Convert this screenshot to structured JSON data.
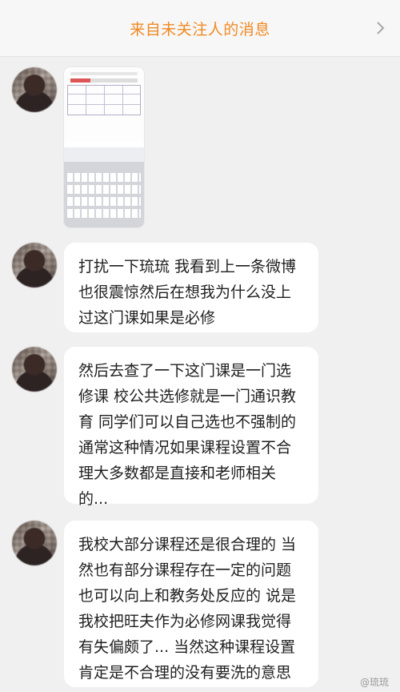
{
  "header": {
    "title": "来自未关注人的消息",
    "chevron_icon": "chevron-right-icon"
  },
  "messages": [
    {
      "type": "image",
      "content_description": ""
    },
    {
      "type": "text",
      "text": "打扰一下琉琉 我看到上一条微博\n也很震惊然后在想我为什么没上\n过这门课如果是必修"
    },
    {
      "type": "text",
      "text": "然后去查了一下这门课是一门选\n修课 校公共选修就是一门通识教\n育 同学们可以自己选也不强制的\n通常这种情况如果课程设置不合\n理大多数都是直接和老师相关\n的..."
    },
    {
      "type": "text",
      "text": "我校大部分课程还是很合理的 当\n然也有部分课程存在一定的问题\n也可以向上和教务处反应的 说是\n我校把旺夫作为必修网课我觉得\n有失偏颇了... 当然这种课程设置\n肯定是不合理的没有要洗的意思"
    }
  ],
  "watermark": "@琉琉",
  "colors": {
    "accent": "#f08a24",
    "background": "#f0f0f0",
    "bubble": "#ffffff"
  }
}
